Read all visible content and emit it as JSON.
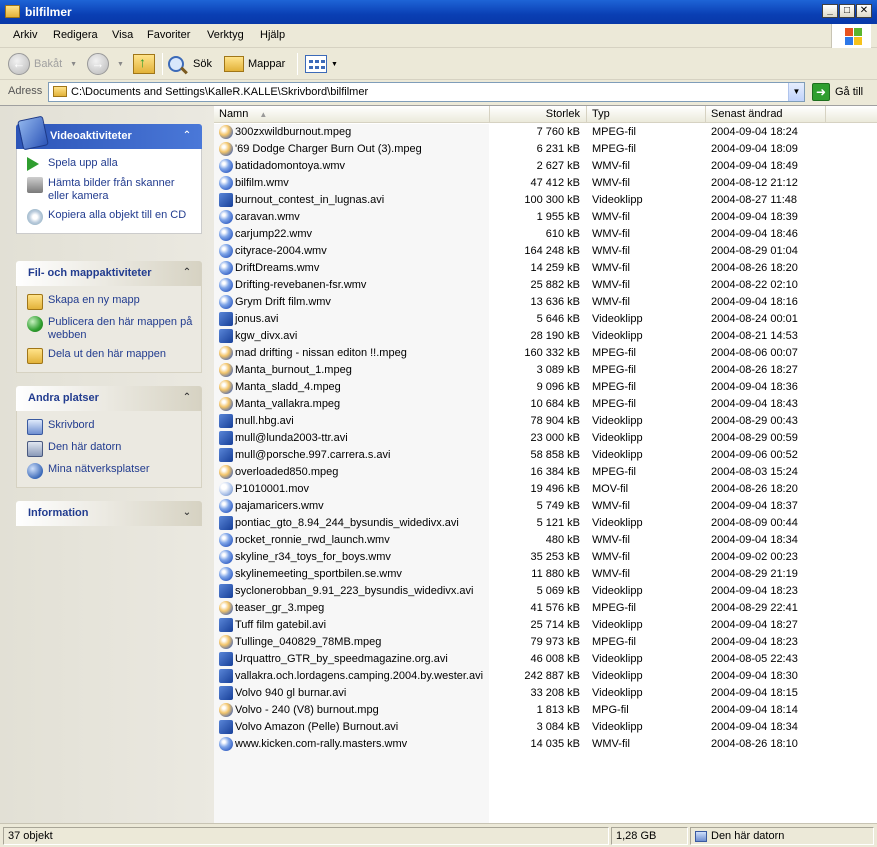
{
  "window": {
    "title": "bilfilmer",
    "min_label": "_",
    "max_label": "□",
    "close_label": "✕"
  },
  "menu": [
    "Arkiv",
    "Redigera",
    "Visa",
    "Favoriter",
    "Verktyg",
    "Hjälp"
  ],
  "toolbar": {
    "back": "Bakåt",
    "search": "Sök",
    "folders": "Mappar"
  },
  "address": {
    "label": "Adress",
    "value": "C:\\Documents and Settings\\KalleR.KALLE\\Skrivbord\\bilfilmer",
    "go": "Gå till"
  },
  "tasks": {
    "video": {
      "title": "Videoaktiviteter",
      "items": [
        "Spela upp alla",
        "Hämta bilder från skanner eller kamera",
        "Kopiera alla objekt till en CD"
      ]
    },
    "file": {
      "title": "Fil- och mappaktiviteter",
      "items": [
        "Skapa en ny mapp",
        "Publicera den här mappen på webben",
        "Dela ut den här mappen"
      ]
    },
    "places": {
      "title": "Andra platser",
      "items": [
        "Skrivbord",
        "Den här datorn",
        "Mina nätverksplatser"
      ]
    },
    "info": {
      "title": "Information"
    }
  },
  "columns": {
    "name": "Namn",
    "size": "Storlek",
    "type": "Typ",
    "modified": "Senast ändrad"
  },
  "files": [
    {
      "name": "300zxwildburnout.mpeg",
      "size": "7 760 kB",
      "type": "MPEG-fil",
      "date": "2004-09-04 18:24",
      "icon": "mpeg"
    },
    {
      "name": "'69 Dodge Charger Burn Out (3).mpeg",
      "size": "6 231 kB",
      "type": "MPEG-fil",
      "date": "2004-09-04 18:09",
      "icon": "mpeg"
    },
    {
      "name": "batidadomontoya.wmv",
      "size": "2 627 kB",
      "type": "WMV-fil",
      "date": "2004-09-04 18:49",
      "icon": "wmv"
    },
    {
      "name": "bilfilm.wmv",
      "size": "47 412 kB",
      "type": "WMV-fil",
      "date": "2004-08-12 21:12",
      "icon": "wmv"
    },
    {
      "name": "burnout_contest_in_lugnas.avi",
      "size": "100 300 kB",
      "type": "Videoklipp",
      "date": "2004-08-27 11:48",
      "icon": "avi"
    },
    {
      "name": "caravan.wmv",
      "size": "1 955 kB",
      "type": "WMV-fil",
      "date": "2004-09-04 18:39",
      "icon": "wmv"
    },
    {
      "name": "carjump22.wmv",
      "size": "610 kB",
      "type": "WMV-fil",
      "date": "2004-09-04 18:46",
      "icon": "wmv"
    },
    {
      "name": "cityrace-2004.wmv",
      "size": "164 248 kB",
      "type": "WMV-fil",
      "date": "2004-08-29 01:04",
      "icon": "wmv"
    },
    {
      "name": "DriftDreams.wmv",
      "size": "14 259 kB",
      "type": "WMV-fil",
      "date": "2004-08-26 18:20",
      "icon": "wmv"
    },
    {
      "name": "Drifting-revebanen-fsr.wmv",
      "size": "25 882 kB",
      "type": "WMV-fil",
      "date": "2004-08-22 02:10",
      "icon": "wmv"
    },
    {
      "name": "Grym Drift film.wmv",
      "size": "13 636 kB",
      "type": "WMV-fil",
      "date": "2004-09-04 18:16",
      "icon": "wmv"
    },
    {
      "name": "jonus.avi",
      "size": "5 646 kB",
      "type": "Videoklipp",
      "date": "2004-08-24 00:01",
      "icon": "avi"
    },
    {
      "name": "kgw_divx.avi",
      "size": "28 190 kB",
      "type": "Videoklipp",
      "date": "2004-08-21 14:53",
      "icon": "avi"
    },
    {
      "name": "mad drifting - nissan editon !!.mpeg",
      "size": "160 332 kB",
      "type": "MPEG-fil",
      "date": "2004-08-06 00:07",
      "icon": "mpeg"
    },
    {
      "name": "Manta_burnout_1.mpeg",
      "size": "3 089 kB",
      "type": "MPEG-fil",
      "date": "2004-08-26 18:27",
      "icon": "mpeg"
    },
    {
      "name": "Manta_sladd_4.mpeg",
      "size": "9 096 kB",
      "type": "MPEG-fil",
      "date": "2004-09-04 18:36",
      "icon": "mpeg"
    },
    {
      "name": "Manta_vallakra.mpeg",
      "size": "10 684 kB",
      "type": "MPEG-fil",
      "date": "2004-09-04 18:43",
      "icon": "mpeg"
    },
    {
      "name": "mull.hbg.avi",
      "size": "78 904 kB",
      "type": "Videoklipp",
      "date": "2004-08-29 00:43",
      "icon": "avi"
    },
    {
      "name": "mull@lunda2003-ttr.avi",
      "size": "23 000 kB",
      "type": "Videoklipp",
      "date": "2004-08-29 00:59",
      "icon": "avi"
    },
    {
      "name": "mull@porsche.997.carrera.s.avi",
      "size": "58 858 kB",
      "type": "Videoklipp",
      "date": "2004-09-06 00:52",
      "icon": "avi"
    },
    {
      "name": "overloaded850.mpeg",
      "size": "16 384 kB",
      "type": "MPEG-fil",
      "date": "2004-08-03 15:24",
      "icon": "mpeg"
    },
    {
      "name": "P1010001.mov",
      "size": "19 496 kB",
      "type": "MOV-fil",
      "date": "2004-08-26 18:20",
      "icon": "mov"
    },
    {
      "name": "pajamaricers.wmv",
      "size": "5 749 kB",
      "type": "WMV-fil",
      "date": "2004-09-04 18:37",
      "icon": "wmv"
    },
    {
      "name": "pontiac_gto_8.94_244_bysundis_widedivx.avi",
      "size": "5 121 kB",
      "type": "Videoklipp",
      "date": "2004-08-09 00:44",
      "icon": "avi"
    },
    {
      "name": "rocket_ronnie_rwd_launch.wmv",
      "size": "480 kB",
      "type": "WMV-fil",
      "date": "2004-09-04 18:34",
      "icon": "wmv"
    },
    {
      "name": "skyline_r34_toys_for_boys.wmv",
      "size": "35 253 kB",
      "type": "WMV-fil",
      "date": "2004-09-02 00:23",
      "icon": "wmv"
    },
    {
      "name": "skylinemeeting_sportbilen.se.wmv",
      "size": "11 880 kB",
      "type": "WMV-fil",
      "date": "2004-08-29 21:19",
      "icon": "wmv"
    },
    {
      "name": "syclonerobban_9.91_223_bysundis_widedivx.avi",
      "size": "5 069 kB",
      "type": "Videoklipp",
      "date": "2004-09-04 18:23",
      "icon": "avi"
    },
    {
      "name": "teaser_gr_3.mpeg",
      "size": "41 576 kB",
      "type": "MPEG-fil",
      "date": "2004-08-29 22:41",
      "icon": "mpeg"
    },
    {
      "name": "Tuff film gatebil.avi",
      "size": "25 714 kB",
      "type": "Videoklipp",
      "date": "2004-09-04 18:27",
      "icon": "avi"
    },
    {
      "name": "Tullinge_040829_78MB.mpeg",
      "size": "79 973 kB",
      "type": "MPEG-fil",
      "date": "2004-09-04 18:23",
      "icon": "mpeg"
    },
    {
      "name": "Urquattro_GTR_by_speedmagazine.org.avi",
      "size": "46 008 kB",
      "type": "Videoklipp",
      "date": "2004-08-05 22:43",
      "icon": "avi"
    },
    {
      "name": "vallakra.och.lordagens.camping.2004.by.wester.avi",
      "size": "242 887 kB",
      "type": "Videoklipp",
      "date": "2004-09-04 18:30",
      "icon": "avi"
    },
    {
      "name": "Volvo 940 gl burnar.avi",
      "size": "33 208 kB",
      "type": "Videoklipp",
      "date": "2004-09-04 18:15",
      "icon": "avi"
    },
    {
      "name": "Volvo - 240 (V8) burnout.mpg",
      "size": "1 813 kB",
      "type": "MPG-fil",
      "date": "2004-09-04 18:14",
      "icon": "mpeg"
    },
    {
      "name": "Volvo Amazon (Pelle) Burnout.avi",
      "size": "3 084 kB",
      "type": "Videoklipp",
      "date": "2004-09-04 18:34",
      "icon": "avi"
    },
    {
      "name": "www.kicken.com-rally.masters.wmv",
      "size": "14 035 kB",
      "type": "WMV-fil",
      "date": "2004-08-26 18:10",
      "icon": "wmv"
    }
  ],
  "status": {
    "count": "37 objekt",
    "size": "1,28 GB",
    "location": "Den här datorn"
  }
}
